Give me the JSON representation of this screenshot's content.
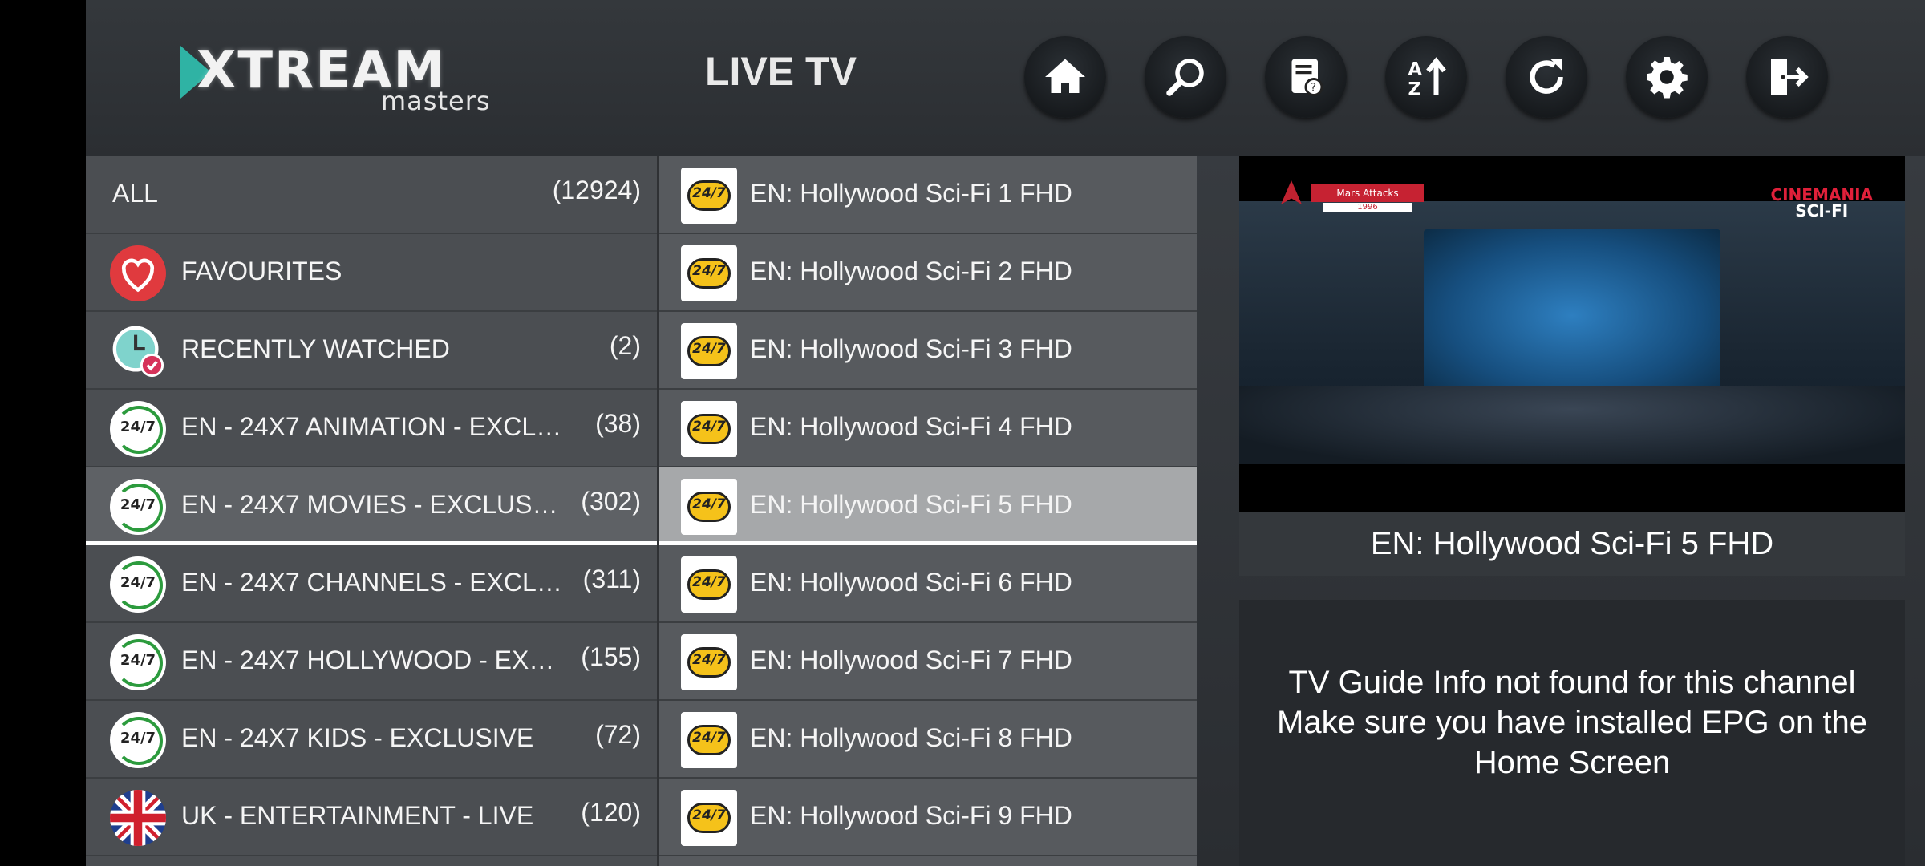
{
  "header": {
    "logo_main": "XTREAM",
    "logo_sub": "masters",
    "title": "LIVE TV",
    "buttons": [
      {
        "name": "home-button",
        "icon": "home-icon"
      },
      {
        "name": "search-button",
        "icon": "search-icon"
      },
      {
        "name": "epg-guide-button",
        "icon": "guide-book-icon"
      },
      {
        "name": "sort-button",
        "icon": "sort-az-icon"
      },
      {
        "name": "refresh-button",
        "icon": "refresh-icon"
      },
      {
        "name": "settings-button",
        "icon": "gear-icon"
      },
      {
        "name": "logout-button",
        "icon": "exit-icon"
      }
    ]
  },
  "categories": [
    {
      "label": "ALL",
      "count": "(12924)",
      "icon": "none"
    },
    {
      "label": "FAVOURITES",
      "count": "",
      "icon": "heart-icon"
    },
    {
      "label": "RECENTLY WATCHED",
      "count": "(2)",
      "icon": "clock-icon"
    },
    {
      "label": "EN - 24X7 ANIMATION - EXCL…",
      "count": "(38)",
      "icon": "247-icon"
    },
    {
      "label": "EN - 24X7 MOVIES - EXCLUS…",
      "count": "(302)",
      "icon": "247-icon"
    },
    {
      "label": "EN - 24X7 CHANNELS - EXCL…",
      "count": "(311)",
      "icon": "247-icon"
    },
    {
      "label": "EN - 24X7 HOLLYWOOD - EX…",
      "count": "(155)",
      "icon": "247-icon"
    },
    {
      "label": "EN - 24X7 KIDS - EXCLUSIVE",
      "count": "(72)",
      "icon": "247-icon"
    },
    {
      "label": "UK - ENTERTAINMENT - LIVE",
      "count": "(120)",
      "icon": "uk-flag-icon"
    }
  ],
  "icon_247_text": "24/7",
  "channel_logo_text": "24/7",
  "channels": [
    {
      "label": "EN: Hollywood Sci-Fi 1 FHD"
    },
    {
      "label": "EN: Hollywood Sci-Fi 2 FHD"
    },
    {
      "label": "EN: Hollywood Sci-Fi 3 FHD"
    },
    {
      "label": "EN: Hollywood Sci-Fi 4 FHD"
    },
    {
      "label": "EN: Hollywood Sci-Fi 5 FHD"
    },
    {
      "label": "EN: Hollywood Sci-Fi 6 FHD"
    },
    {
      "label": "EN: Hollywood Sci-Fi 7 FHD"
    },
    {
      "label": "EN: Hollywood Sci-Fi 8 FHD"
    },
    {
      "label": "EN: Hollywood Sci-Fi 9 FHD"
    }
  ],
  "selected_index": 4,
  "player": {
    "overlay_title": "Mars Attacks",
    "overlay_year": "1996",
    "brand_main": "CINEMANIA",
    "brand_sub": "SCI-FI"
  },
  "now_playing": "EN: Hollywood Sci-Fi 5 FHD",
  "epg": {
    "line1": "TV Guide Info not found for this channel",
    "line2": "Make sure you have installed EPG on the Home Screen"
  },
  "colors": {
    "background": "#3a3e43",
    "selected_row": "#a6a8aa",
    "accent_green": "#2c9b3d",
    "heart_red": "#e03a3e"
  }
}
